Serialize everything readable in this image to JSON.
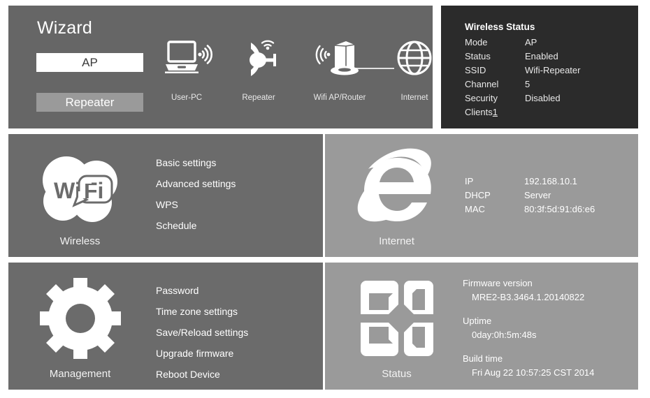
{
  "wizard": {
    "title": "Wizard",
    "modes": [
      {
        "label": "AP",
        "selected": true
      },
      {
        "label": "Repeater",
        "selected": false
      }
    ],
    "topology": [
      {
        "label": "User-PC",
        "icon": "laptop-wifi-icon"
      },
      {
        "label": "Repeater",
        "icon": "satellite-dish-icon"
      },
      {
        "label": "Wifi AP/Router",
        "icon": "router-icon"
      },
      {
        "label": "Internet",
        "icon": "globe-icon"
      }
    ]
  },
  "wireless_status": {
    "title": "Wireless Status",
    "rows": [
      {
        "key": "Mode",
        "value": "AP"
      },
      {
        "key": "Status",
        "value": "Enabled"
      },
      {
        "key": "SSID",
        "value": "Wifi-Repeater"
      },
      {
        "key": "Channel",
        "value": "5"
      },
      {
        "key": "Security",
        "value": "Disabled"
      }
    ],
    "clients_label": "Clients",
    "clients_value": "1"
  },
  "wireless": {
    "caption": "Wireless",
    "icon": "wifi-logo-icon",
    "menu": [
      "Basic settings",
      "Advanced settings",
      "WPS",
      "Schedule"
    ]
  },
  "internet": {
    "caption": "Internet",
    "icon": "internet-explorer-icon",
    "rows": [
      {
        "key": "IP",
        "value": "192.168.10.1"
      },
      {
        "key": "DHCP",
        "value": "Server"
      },
      {
        "key": "MAC",
        "value": "80:3f:5d:91:d6:e6"
      }
    ]
  },
  "management": {
    "caption": "Management",
    "icon": "gear-icon",
    "menu": [
      "Password",
      "Time zone settings",
      "Save/Reload settings",
      "Upgrade firmware",
      "Reboot Device"
    ]
  },
  "status": {
    "caption": "Status",
    "icon": "office-pinwheel-icon",
    "groups": [
      {
        "label": "Firmware version",
        "value": "MRE2-B3.3464.1.20140822"
      },
      {
        "label": "Uptime",
        "value": "0day:0h:5m:48s"
      },
      {
        "label": "Build time",
        "value": "Fri Aug 22 10:57:25 CST 2014"
      }
    ]
  },
  "colors": {
    "page_background": "#ffffff",
    "panel_dark": "#2b2b2b",
    "panel_mid": "#6b6b6b",
    "panel_light": "#9a9a9a",
    "wizard_panel": "#666666",
    "text_primary": "#ffffff",
    "selected_button_bg": "#ffffff",
    "selected_button_text": "#3a3a3a"
  }
}
